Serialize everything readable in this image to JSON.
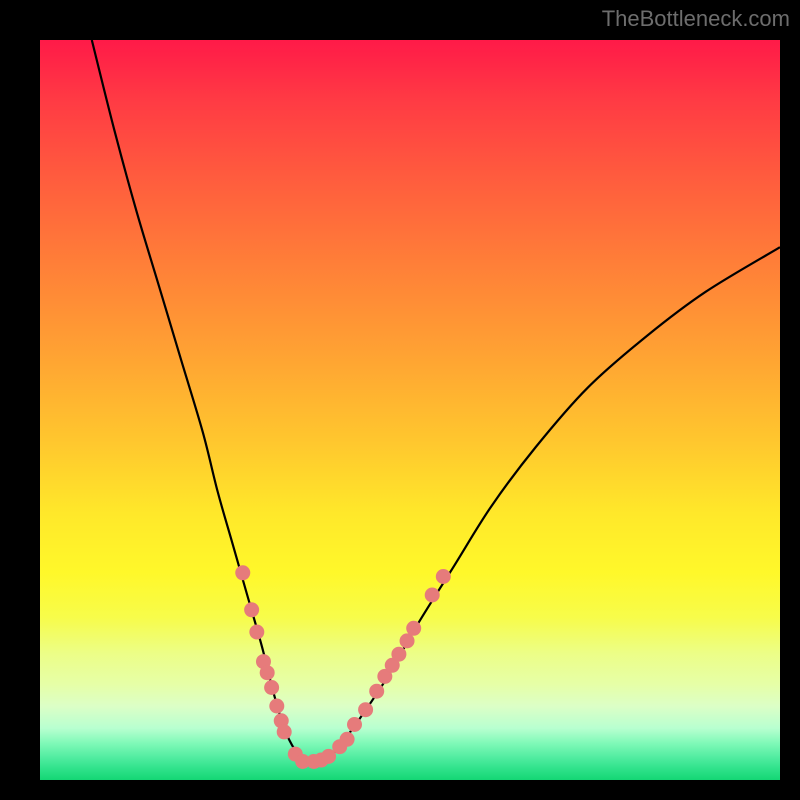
{
  "watermark": "TheBottleneck.com",
  "chart_data": {
    "type": "line",
    "title": "",
    "xlabel": "",
    "ylabel": "",
    "xlim": [
      0,
      100
    ],
    "ylim": [
      0,
      100
    ],
    "grid": false,
    "legend": false,
    "series": [
      {
        "name": "bottleneck-curve",
        "stroke": "#000000",
        "x": [
          7,
          10,
          13,
          16,
          19,
          22,
          24,
          26,
          28,
          30,
          31.5,
          33,
          34.5,
          36,
          38,
          40,
          43,
          47,
          51,
          56,
          61,
          67,
          74,
          82,
          90,
          100
        ],
        "y": [
          100,
          88,
          77,
          67,
          57,
          47,
          39,
          32,
          25,
          18,
          12,
          7,
          4,
          2.5,
          2.5,
          4,
          8,
          14,
          21,
          29,
          37,
          45,
          53,
          60,
          66,
          72
        ]
      }
    ],
    "markers": {
      "name": "highlighted-points",
      "color": "#e67b7b",
      "points": [
        {
          "x": 27.4,
          "y": 28
        },
        {
          "x": 28.6,
          "y": 23
        },
        {
          "x": 29.3,
          "y": 20
        },
        {
          "x": 30.2,
          "y": 16
        },
        {
          "x": 30.7,
          "y": 14.5
        },
        {
          "x": 31.3,
          "y": 12.5
        },
        {
          "x": 32.0,
          "y": 10
        },
        {
          "x": 32.6,
          "y": 8
        },
        {
          "x": 33.0,
          "y": 6.5
        },
        {
          "x": 34.5,
          "y": 3.5
        },
        {
          "x": 35.5,
          "y": 2.5
        },
        {
          "x": 37.0,
          "y": 2.5
        },
        {
          "x": 38.0,
          "y": 2.7
        },
        {
          "x": 39.0,
          "y": 3.2
        },
        {
          "x": 40.5,
          "y": 4.5
        },
        {
          "x": 41.5,
          "y": 5.5
        },
        {
          "x": 42.5,
          "y": 7.5
        },
        {
          "x": 44.0,
          "y": 9.5
        },
        {
          "x": 45.5,
          "y": 12
        },
        {
          "x": 46.6,
          "y": 14
        },
        {
          "x": 47.6,
          "y": 15.5
        },
        {
          "x": 48.5,
          "y": 17
        },
        {
          "x": 49.6,
          "y": 18.8
        },
        {
          "x": 50.5,
          "y": 20.5
        },
        {
          "x": 53.0,
          "y": 25
        },
        {
          "x": 54.5,
          "y": 27.5
        }
      ]
    }
  }
}
